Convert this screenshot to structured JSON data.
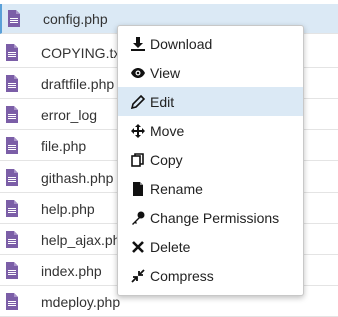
{
  "files": [
    {
      "name": "config.php"
    },
    {
      "name": "COPYING.txt"
    },
    {
      "name": "draftfile.php"
    },
    {
      "name": "error_log"
    },
    {
      "name": "file.php"
    },
    {
      "name": "githash.php"
    },
    {
      "name": "help.php"
    },
    {
      "name": "help_ajax.php"
    },
    {
      "name": "index.php"
    },
    {
      "name": "mdeploy.php"
    }
  ],
  "context_menu": {
    "items": [
      {
        "label": "Download",
        "icon": "download-icon"
      },
      {
        "label": "View",
        "icon": "eye-icon"
      },
      {
        "label": "Edit",
        "icon": "pencil-icon"
      },
      {
        "label": "Move",
        "icon": "move-arrows-icon"
      },
      {
        "label": "Copy",
        "icon": "copy-icon"
      },
      {
        "label": "Rename",
        "icon": "file-icon"
      },
      {
        "label": "Change Permissions",
        "icon": "key-icon"
      },
      {
        "label": "Delete",
        "icon": "x-icon"
      },
      {
        "label": "Compress",
        "icon": "compress-icon"
      }
    ]
  },
  "colors": {
    "file_icon": "#7b5ea7",
    "selected_row": "#dbe9f5",
    "menu_hover": "#dbe9f5"
  }
}
